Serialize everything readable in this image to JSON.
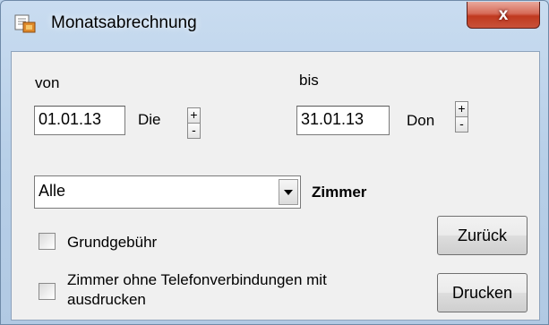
{
  "window": {
    "title": "Monatsabrechnung",
    "close_label": "x",
    "icon": "report-icon"
  },
  "from": {
    "label": "von",
    "date": "01.01.13",
    "weekday": "Die",
    "increment": "+",
    "decrement": "-"
  },
  "to": {
    "label": "bis",
    "date": "31.01.13",
    "weekday": "Don",
    "increment": "+",
    "decrement": "-"
  },
  "room": {
    "selected": "Alle",
    "label": "Zimmer"
  },
  "options": {
    "base_fee": {
      "label": "Grundgebühr",
      "checked": false
    },
    "rooms_without_calls": {
      "label_line1": "Zimmer ohne Telefonverbindungen mit",
      "label_line2": "ausdrucken",
      "checked": false
    }
  },
  "buttons": {
    "back": "Zurück",
    "print": "Drucken"
  }
}
